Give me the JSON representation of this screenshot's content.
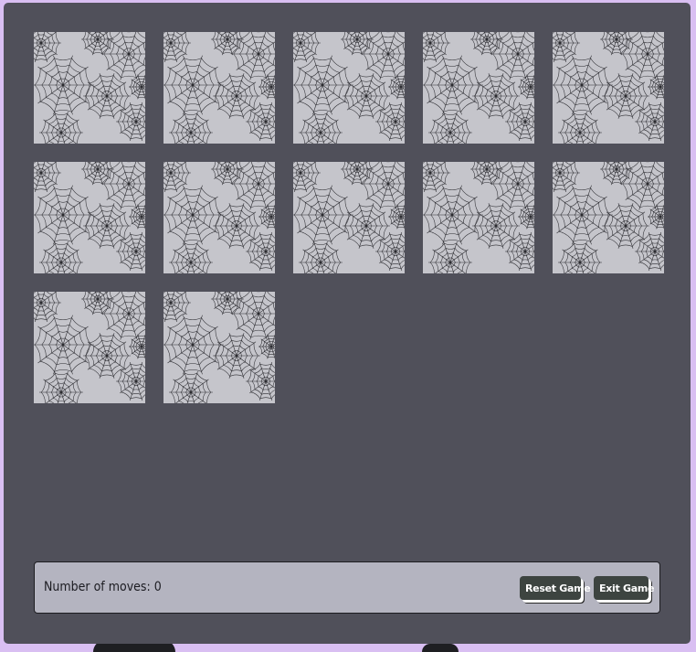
{
  "board": {
    "card_count": 12,
    "cards": [
      {
        "state": "face-down",
        "pattern": "spider-web"
      },
      {
        "state": "face-down",
        "pattern": "spider-web"
      },
      {
        "state": "face-down",
        "pattern": "spider-web"
      },
      {
        "state": "face-down",
        "pattern": "spider-web"
      },
      {
        "state": "face-down",
        "pattern": "spider-web"
      },
      {
        "state": "face-down",
        "pattern": "spider-web"
      },
      {
        "state": "face-down",
        "pattern": "spider-web"
      },
      {
        "state": "face-down",
        "pattern": "spider-web"
      },
      {
        "state": "face-down",
        "pattern": "spider-web"
      },
      {
        "state": "face-down",
        "pattern": "spider-web"
      },
      {
        "state": "face-down",
        "pattern": "spider-web"
      },
      {
        "state": "face-down",
        "pattern": "spider-web"
      }
    ]
  },
  "status": {
    "moves_label": "Number of moves: 0",
    "reset_label": "Reset Game",
    "exit_label": "Exit Game"
  },
  "colors": {
    "page_background": "#d9bff2",
    "board_background": "#50505a",
    "card_back": "#c5c5cb",
    "web_stroke": "#2b2b30",
    "status_bar": "#b4b4c0",
    "button": "#3d4440"
  }
}
